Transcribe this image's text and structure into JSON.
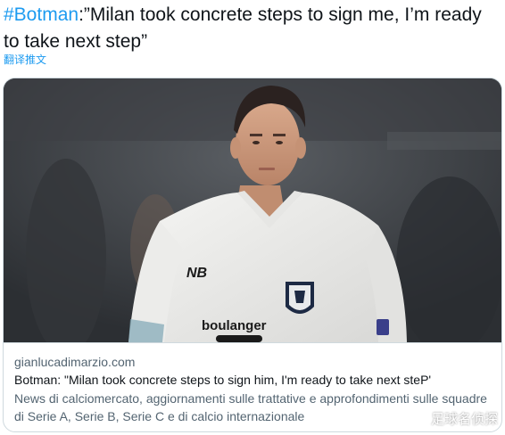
{
  "tweet": {
    "hashtag": "#Botman",
    "text": ":”Milan took concrete steps to sign me, I’m ready to take next step”",
    "translate_label": "翻译推文"
  },
  "card": {
    "jersey_sponsor": "boulanger",
    "domain": "gianlucadimarzio.com",
    "title": "Botman: \"Milan took concrete steps to sign him, I'm ready to take next steP'",
    "description": "News di calciomercato, aggiornamenti sulle trattative e approfondimenti sulle squadre di Serie A, Serie B, Serie C e di calcio internazionale"
  },
  "watermark": {
    "text": "足球名侦探",
    "icon": "wechat-icon"
  },
  "colors": {
    "link": "#1d9bf0",
    "text": "#0f1419",
    "secondary": "#536471",
    "border": "#cfd9de"
  }
}
